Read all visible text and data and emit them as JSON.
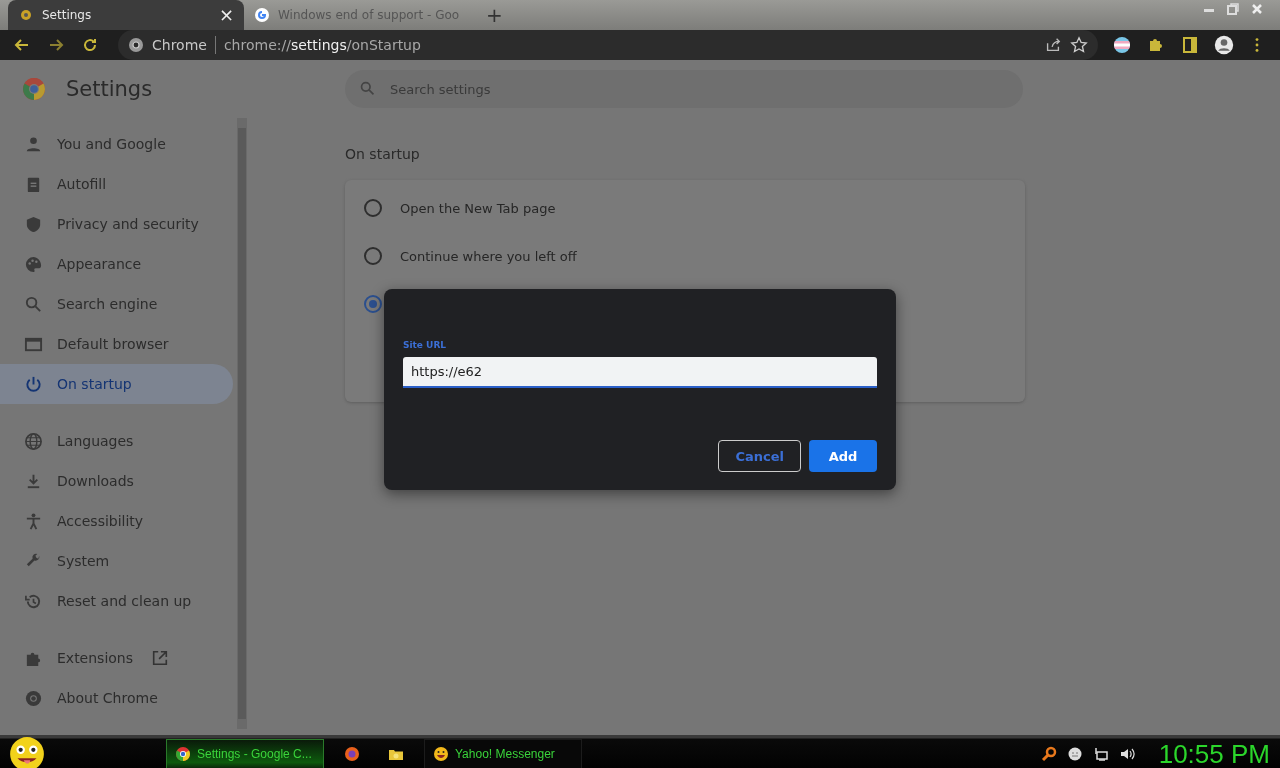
{
  "tabs": [
    {
      "title": "Settings",
      "selected": true,
      "close": "×"
    },
    {
      "title": "Windows end of support - Goo",
      "selected": false
    }
  ],
  "new_tab": "+",
  "omnibox": {
    "site": "Chrome",
    "url_prefix": "chrome://",
    "url_host": "settings",
    "url_path": "/onStartup"
  },
  "sidebar": {
    "title": "Settings",
    "sections": [
      [
        {
          "label": "You and Google",
          "selected": false
        },
        {
          "label": "Autofill",
          "selected": false
        },
        {
          "label": "Privacy and security",
          "selected": false
        },
        {
          "label": "Appearance",
          "selected": false
        },
        {
          "label": "Search engine",
          "selected": false
        },
        {
          "label": "Default browser",
          "selected": false
        },
        {
          "label": "On startup",
          "selected": true
        }
      ],
      [
        {
          "label": "Languages",
          "selected": false
        },
        {
          "label": "Downloads",
          "selected": false
        },
        {
          "label": "Accessibility",
          "selected": false
        },
        {
          "label": "System",
          "selected": false
        },
        {
          "label": "Reset and clean up",
          "selected": false
        }
      ],
      [
        {
          "label": "Extensions",
          "selected": false
        },
        {
          "label": "About Chrome",
          "selected": false
        }
      ]
    ]
  },
  "search": {
    "placeholder": "Search settings"
  },
  "section_title": "On startup",
  "startup_options": [
    {
      "label": "Open the New Tab page",
      "selected": false
    },
    {
      "label": "Continue where you left off",
      "selected": false
    },
    {
      "selected": true
    }
  ],
  "dialog": {
    "field_label": "Site URL",
    "value": "https://e62",
    "buttons": [
      {
        "label": "Cancel",
        "kind": "secondary"
      },
      {
        "label": "Add",
        "kind": "primary"
      }
    ]
  },
  "taskbar": {
    "tasks": [
      {
        "label": "Settings - Google C...",
        "selected": true,
        "kind": "chrome"
      },
      {
        "kind": "firefox",
        "selected": false
      },
      {
        "kind": "folder",
        "selected": false
      },
      {
        "label": "Yahoo! Messenger",
        "selected": false,
        "kind": "messenger"
      }
    ],
    "clock": "10:55 PM"
  }
}
